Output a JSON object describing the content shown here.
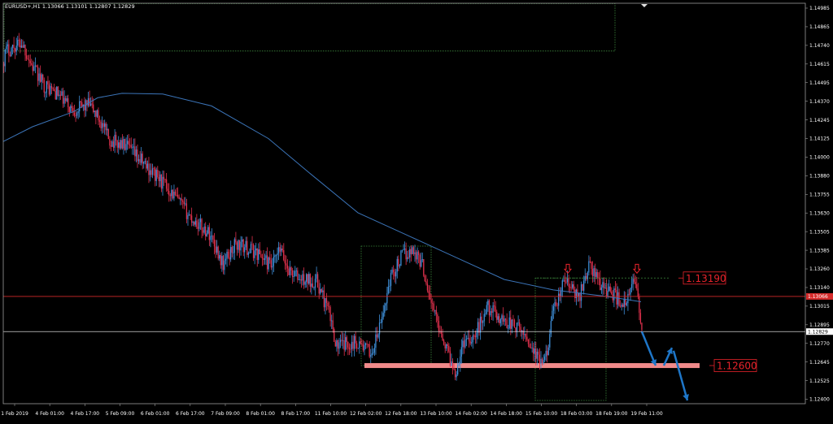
{
  "header": {
    "symbol_line": "EURUSD+,H1  1.13066 1.13101 1.12807 1.12829"
  },
  "colors": {
    "background": "#000000",
    "bull": "#3f8fd9",
    "bear": "#e0314d",
    "ma": "#3b74b8",
    "zone_border": "#3d8a3d",
    "support_band": "#f08a8a",
    "level_text": "#e8232b",
    "current_price_line": "#ffffff",
    "red_hline": "#d42a2a",
    "forecast_arrow": "#1e76c8"
  },
  "chart_data": {
    "type": "candlestick",
    "symbol": "EURUSD+",
    "timeframe": "H1",
    "ohlc_last": {
      "open": 1.13066,
      "high": 1.13101,
      "low": 1.12807,
      "close": 1.12829
    },
    "ylim": [
      1.12343,
      1.15042
    ],
    "y_ticks": [
      "1.14985",
      "1.14865",
      "1.14740",
      "1.14615",
      "1.14495",
      "1.14370",
      "1.14245",
      "1.14125",
      "1.14000",
      "1.13880",
      "1.13755",
      "1.13630",
      "1.13505",
      "1.13385",
      "1.13260",
      "1.13140",
      "1.13015",
      "1.12895",
      "1.12770",
      "1.12645",
      "1.12525",
      "1.12400"
    ],
    "x_ticks": [
      "1 Feb 2019",
      "4 Feb 01:00",
      "4 Feb 17:00",
      "5 Feb 09:00",
      "6 Feb 01:00",
      "6 Feb 17:00",
      "7 Feb 09:00",
      "8 Feb 01:00",
      "8 Feb 17:00",
      "11 Feb 10:00",
      "12 Feb 02:00",
      "12 Feb 18:00",
      "13 Feb 10:00",
      "14 Feb 02:00",
      "14 Feb 18:00",
      "15 Feb 10:00",
      "18 Feb 03:00",
      "18 Feb 19:00",
      "19 Feb 11:00"
    ],
    "price_path": [
      [
        0,
        1.1455
      ],
      [
        8,
        1.1472
      ],
      [
        28,
        1.1478
      ],
      [
        40,
        1.1462
      ],
      [
        55,
        1.1449
      ],
      [
        72,
        1.1443
      ],
      [
        90,
        1.1432
      ],
      [
        110,
        1.1436
      ],
      [
        122,
        1.1427
      ],
      [
        135,
        1.1412
      ],
      [
        155,
        1.1408
      ],
      [
        180,
        1.1395
      ],
      [
        210,
        1.1378
      ],
      [
        235,
        1.136
      ],
      [
        260,
        1.1348
      ],
      [
        275,
        1.1328
      ],
      [
        290,
        1.1342
      ],
      [
        305,
        1.1339
      ],
      [
        320,
        1.1335
      ],
      [
        335,
        1.1326
      ],
      [
        345,
        1.1338
      ],
      [
        355,
        1.1325
      ],
      [
        370,
        1.1318
      ],
      [
        390,
        1.1317
      ],
      [
        405,
        1.1296
      ],
      [
        415,
        1.1273
      ],
      [
        430,
        1.1275
      ],
      [
        440,
        1.1276
      ],
      [
        458,
        1.1268
      ],
      [
        470,
        1.129
      ],
      [
        480,
        1.1318
      ],
      [
        495,
        1.1334
      ],
      [
        510,
        1.1338
      ],
      [
        520,
        1.1328
      ],
      [
        532,
        1.13
      ],
      [
        545,
        1.128
      ],
      [
        560,
        1.1255
      ],
      [
        572,
        1.1278
      ],
      [
        585,
        1.128
      ],
      [
        600,
        1.13
      ],
      [
        615,
        1.1292
      ],
      [
        630,
        1.1288
      ],
      [
        648,
        1.128
      ],
      [
        662,
        1.1264
      ],
      [
        670,
        1.126
      ],
      [
        680,
        1.1293
      ],
      [
        695,
        1.1318
      ],
      [
        712,
        1.1305
      ],
      [
        725,
        1.1328
      ],
      [
        740,
        1.1314
      ],
      [
        755,
        1.1308
      ],
      [
        770,
        1.13
      ],
      [
        782,
        1.132
      ],
      [
        790,
        1.1283
      ]
    ],
    "moving_average": [
      [
        4,
        1.1411
      ],
      [
        40,
        1.1421
      ],
      [
        90,
        1.1431
      ],
      [
        120,
        1.14405
      ],
      [
        150,
        1.14435
      ],
      [
        200,
        1.1443
      ],
      [
        260,
        1.1435
      ],
      [
        330,
        1.1413
      ],
      [
        380,
        1.139
      ],
      [
        440,
        1.1363
      ],
      [
        500,
        1.1348
      ],
      [
        560,
        1.1333
      ],
      [
        620,
        1.1318
      ],
      [
        680,
        1.1311
      ],
      [
        740,
        1.1307
      ],
      [
        788,
        1.1303
      ]
    ],
    "current_price": 1.12829,
    "red_hline_price": 1.13066,
    "red_hline_label": "1.13066",
    "levels": [
      {
        "label": "1.13190",
        "price": 1.1319,
        "style": "dashed-green",
        "x_from": 660,
        "x_to": 822
      },
      {
        "label": "1.12600",
        "price": 1.126,
        "style": "support-band",
        "x_from": 448,
        "x_to": 860
      }
    ],
    "zones": [
      {
        "x_from": 5,
        "x_to": 756,
        "price_from": 1.1472,
        "price_to": 1.1504
      },
      {
        "x_from": 444,
        "x_to": 530,
        "price_from": 1.126,
        "price_to": 1.13405
      },
      {
        "x_from": 658,
        "x_to": 745,
        "price_from": 1.12365,
        "price_to": 1.1319
      }
    ],
    "markers": [
      {
        "x": 698,
        "price": 1.1325
      },
      {
        "x": 783,
        "price": 1.1325
      }
    ],
    "forecast_arrows": [
      {
        "from": [
          789,
          1.12829
        ],
        "to": [
          806,
          1.126
        ]
      },
      {
        "from": [
          816,
          1.126
        ],
        "to": [
          826,
          1.1272
        ]
      },
      {
        "from": [
          828,
          1.127
        ],
        "to": [
          845,
          1.12365
        ]
      }
    ]
  }
}
